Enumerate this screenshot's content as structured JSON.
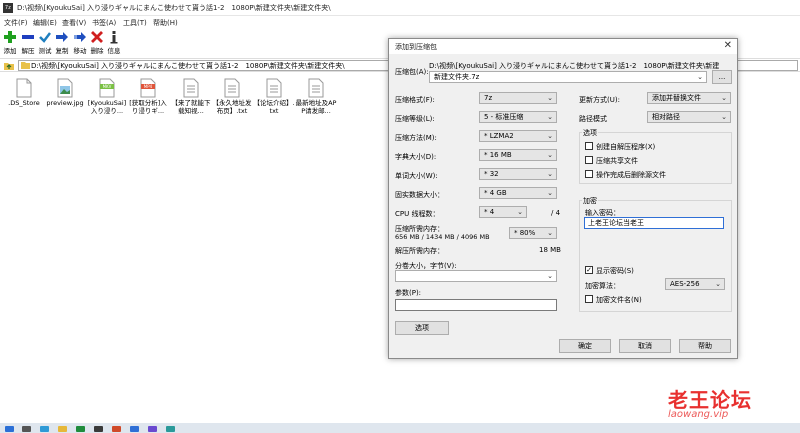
{
  "window": {
    "title": "D:\\视频\\[KyoukuSai] 入り浸りギャルにまんこ使わせて貰う話1-2　1080P\\新建文件夹\\新建文件夹\\",
    "app_icon": "7z"
  },
  "menu": [
    "文件(F)",
    "编辑(E)",
    "查看(V)",
    "书签(A)",
    "工具(T)",
    "帮助(H)"
  ],
  "toolbar": [
    {
      "label": "添加",
      "icon": "plus-icon",
      "color": "#1fa01f"
    },
    {
      "label": "解压",
      "icon": "minus-icon",
      "color": "#1f3fbf"
    },
    {
      "label": "测试",
      "icon": "check-icon",
      "color": "#1f7fbf"
    },
    {
      "label": "复制",
      "icon": "copy-arrow-icon",
      "color": "#1f4fbf"
    },
    {
      "label": "移动",
      "icon": "move-arrow-icon",
      "color": "#1f4fbf"
    },
    {
      "label": "删除",
      "icon": "delete-x-icon",
      "color": "#d01f1f"
    },
    {
      "label": "信息",
      "icon": "info-icon",
      "color": "#333333"
    }
  ],
  "address": {
    "path": "D:\\视频\\[KyoukuSai] 入り浸りギャルにまんこ使わせて貰う話1-2　1080P\\新建文件夹\\新建文件夹\\"
  },
  "files": [
    {
      "name": ".DS_Store",
      "icon": "blank-file-icon"
    },
    {
      "name": "preview.jpg",
      "icon": "image-file-icon"
    },
    {
      "name": "[KyoukuSai] 入り浸り...",
      "icon": "mkv-file-icon",
      "badge": "MKV"
    },
    {
      "name": "[获取分析]入り浸りギ...",
      "icon": "mp4-file-icon",
      "badge": "MP4"
    },
    {
      "name": "【来了就能下载知视...",
      "icon": "text-file-icon"
    },
    {
      "name": "【永久地址发布页】.txt",
      "icon": "text-file-icon"
    },
    {
      "name": "【论坛介绍】.txt",
      "icon": "text-file-icon"
    },
    {
      "name": "最新地址及APP请发邮...",
      "icon": "text-file-icon"
    }
  ],
  "dialog": {
    "title": "添加到压缩包",
    "archive_label": "压缩包(A):",
    "archive_path": "D:\\视频\\[KyoukuSai] 入り浸りギャルにまんこ使わせて貰う話1-2　1080P\\新建文件夹\\新建",
    "archive_name": "新建文件夹.7z",
    "browse": "...",
    "format_label": "压缩格式(F):",
    "format_value": "7z",
    "level_label": "压缩等级(L):",
    "level_value": "5 - 标准压缩",
    "method_label": "压缩方法(M):",
    "method_value": "* LZMA2",
    "dict_label": "字典大小(D):",
    "dict_value": "* 16 MB",
    "word_label": "单词大小(W):",
    "word_value": "* 32",
    "solid_label": "固实数据大小：",
    "solid_value": "* 4 GB",
    "cpu_label": "CPU 线程数：",
    "cpu_value": "* 4",
    "cpu_total": "/ 4",
    "mem_label": "压缩所需内存：",
    "mem_detail": "656 MB / 1434 MB / 4096 MB",
    "mem_pct": "* 80%",
    "unmem_label": "解压所需内存：",
    "unmem_value": "18 MB",
    "split_label": "分卷大小，字节(V):",
    "param_label": "参数(P):",
    "options_button": "选项",
    "update_label": "更新方式(U):",
    "update_value": "添加并替换文件",
    "pathmode_label": "路径模式",
    "pathmode_value": "相对路径",
    "options_group": "选项",
    "opt_sfx": "创建自解压程序(X)",
    "opt_shared": "压缩共享文件",
    "opt_delete": "操作完成后删除源文件",
    "enc_group": "加密",
    "pwd_label": "输入密码：",
    "pwd_value": "上老王论坛当老王",
    "show_pwd": "显示密码(S)",
    "enc_method_label": "加密算法：",
    "enc_method_value": "AES-256",
    "enc_names": "加密文件名(N)",
    "ok": "确定",
    "cancel": "取消",
    "help": "帮助",
    "show_pwd_checked": true
  },
  "watermark": {
    "line1": "老王论坛",
    "line2": "laowang.vip"
  }
}
